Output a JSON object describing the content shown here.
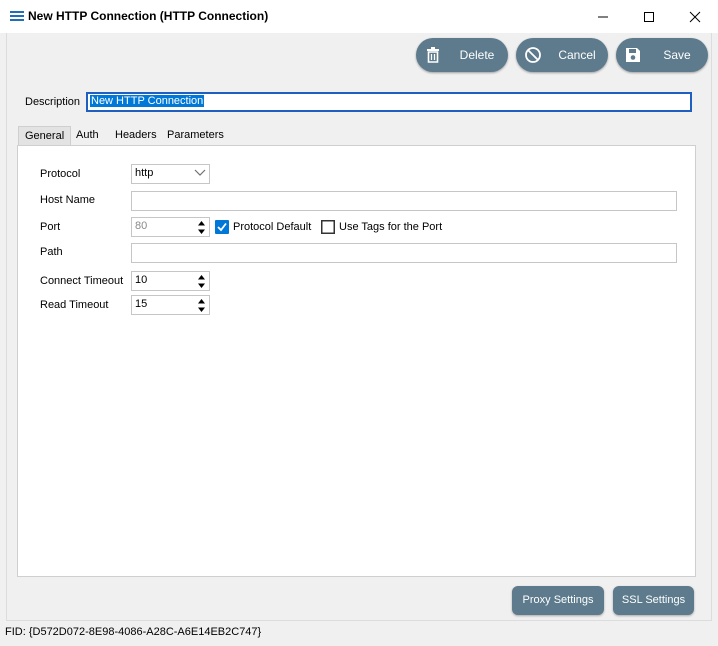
{
  "window": {
    "title": "New HTTP Connection (HTTP Connection)",
    "controls": {
      "minimize": "minimize-icon",
      "maximize": "maximize-icon",
      "close": "close-icon"
    }
  },
  "toolbar": {
    "delete_label": "Delete",
    "cancel_label": "Cancel",
    "save_label": "Save",
    "button_color": "#5d7b8c"
  },
  "description": {
    "label": "Description",
    "value": "New HTTP Connection"
  },
  "tabs": [
    {
      "label": "General",
      "active": true
    },
    {
      "label": "Auth",
      "active": false
    },
    {
      "label": "Headers",
      "active": false
    },
    {
      "label": "Parameters",
      "active": false
    }
  ],
  "general": {
    "protocol": {
      "label": "Protocol",
      "value": "http"
    },
    "host_name": {
      "label": "Host Name",
      "value": ""
    },
    "port": {
      "label": "Port",
      "value": "80"
    },
    "protocol_default": {
      "label": "Protocol Default",
      "checked": true
    },
    "use_tags": {
      "label": "Use Tags for the Port",
      "checked": false
    },
    "path": {
      "label": "Path",
      "value": ""
    },
    "connect_timeout": {
      "label": "Connect Timeout",
      "value": "10"
    },
    "read_timeout": {
      "label": "Read Timeout",
      "value": "15"
    }
  },
  "footer": {
    "proxy_label": "Proxy Settings",
    "ssl_label": "SSL Settings",
    "fid": "FID: {D572D072-8E98-4086-A28C-A6E14EB2C747}"
  },
  "colors": {
    "accent": "#1f5fbf",
    "selection": "#0078d7",
    "checkbox": "#0078d7"
  }
}
